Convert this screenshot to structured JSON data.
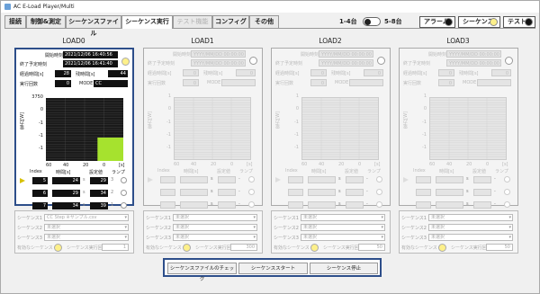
{
  "window_title": "AC E-Load Player/Multi",
  "tabs": [
    {
      "label": "接続",
      "state": "normal"
    },
    {
      "label": "制御&測定",
      "state": "normal"
    },
    {
      "label": "シーケンスファイル",
      "state": "normal"
    },
    {
      "label": "シーケンス実行",
      "state": "active"
    },
    {
      "label": "テスト機能",
      "state": "disabled"
    },
    {
      "label": "コンフィグ",
      "state": "normal"
    },
    {
      "label": "その他",
      "state": "normal"
    }
  ],
  "range": {
    "left": "1-4台",
    "right": "5-8台"
  },
  "indicators": [
    {
      "label": "アラーム",
      "color": "#111111"
    },
    {
      "label": "シーケンス",
      "color": "#fdf08a"
    },
    {
      "label": "テスト",
      "color": "#111111"
    }
  ],
  "loads": [
    {
      "title": "LOAD0",
      "active": true,
      "start_label": "開始時刻",
      "start": "2021/12/06 16:40:56",
      "end_label": "終了予定時刻",
      "end": "2021/12/06 16:41:40",
      "elapsed_label": "経過時間[s]",
      "elapsed": "28",
      "remain_label": "残時間[s]",
      "remain": "44",
      "count_label": "実行回数",
      "count": "0",
      "mode_label": "MODE",
      "mode": "CC",
      "ylabel": "電力[W]",
      "yticks": [
        "3750",
        "0",
        "-1",
        "-1",
        "-1"
      ],
      "xticks": [
        "60",
        "40",
        "20",
        "0"
      ],
      "xunit": "[s]",
      "headers": [
        "Index",
        "時間[s]",
        "設定値",
        "ランプ"
      ],
      "rows": [
        {
          "index": "5",
          "time": "24",
          "set": "29",
          "tunit": "s",
          "sunit": "3"
        },
        {
          "index": "6",
          "time": "29",
          "set": "34",
          "tunit": "s",
          "sunit": "2"
        },
        {
          "index": "7",
          "time": "34",
          "set": "39",
          "tunit": "s",
          "sunit": "1"
        }
      ],
      "seq": [
        {
          "label": "シーケンス1",
          "value": "CC Step ※サンプル.csv"
        },
        {
          "label": "シーケンス2",
          "value": "未選択"
        },
        {
          "label": "シーケンス3",
          "value": "未選択"
        }
      ],
      "valid_label": "有効なシーケンス",
      "repeat_label": "シーケンス実行回数",
      "repeat": "1"
    },
    {
      "title": "LOAD1",
      "active": false,
      "start_label": "開始時刻",
      "start": "YYYY/MM/DD 00:00:00",
      "end_label": "終了予定時刻",
      "end": "YYYY/MM/DD 00:00:00",
      "elapsed_label": "経過時間[s]",
      "elapsed": "0",
      "remain_label": "残時間[s]",
      "remain": "0",
      "count_label": "実行回数",
      "count": "0",
      "mode_label": "MODE",
      "mode": "",
      "ylabel": "電力[W]",
      "yticks": [
        "1",
        "0",
        "-1",
        "-1",
        "-1"
      ],
      "xticks": [
        "60",
        "40",
        "20",
        "0"
      ],
      "xunit": "[s]",
      "headers": [
        "Index",
        "時間[s]",
        "設定値",
        "ランプ"
      ],
      "rows": [
        {
          "index": "",
          "time": "",
          "set": "",
          "tunit": "s",
          "sunit": "-"
        },
        {
          "index": "",
          "time": "",
          "set": "",
          "tunit": "s",
          "sunit": "-"
        },
        {
          "index": "",
          "time": "",
          "set": "",
          "tunit": "s",
          "sunit": "-"
        }
      ],
      "seq": [
        {
          "label": "シーケンス1",
          "value": "未選択"
        },
        {
          "label": "シーケンス2",
          "value": "未選択"
        },
        {
          "label": "シーケンス3",
          "value": "未選択"
        }
      ],
      "valid_label": "有効なシーケンス",
      "repeat_label": "シーケンス実行回数",
      "repeat": "300"
    },
    {
      "title": "LOAD2",
      "active": false,
      "start_label": "開始時刻",
      "start": "YYYY/MM/DD 00:00:00",
      "end_label": "終了予定時刻",
      "end": "YYYY/MM/DD 00:00:00",
      "elapsed_label": "経過時間[s]",
      "elapsed": "0",
      "remain_label": "残時間[s]",
      "remain": "0",
      "count_label": "実行回数",
      "count": "0",
      "mode_label": "MODE",
      "mode": "",
      "ylabel": "電力[W]",
      "yticks": [
        "1",
        "0",
        "-1",
        "-1",
        "-1"
      ],
      "xticks": [
        "60",
        "40",
        "20",
        "0"
      ],
      "xunit": "[s]",
      "headers": [
        "Index",
        "時間[s]",
        "設定値",
        "ランプ"
      ],
      "rows": [
        {
          "index": "",
          "time": "",
          "set": "",
          "tunit": "s",
          "sunit": "-"
        },
        {
          "index": "",
          "time": "",
          "set": "",
          "tunit": "s",
          "sunit": "-"
        },
        {
          "index": "",
          "time": "",
          "set": "",
          "tunit": "s",
          "sunit": "-"
        }
      ],
      "seq": [
        {
          "label": "シーケンス1",
          "value": "未選択"
        },
        {
          "label": "シーケンス2",
          "value": "未選択"
        },
        {
          "label": "シーケンス3",
          "value": "未選択"
        }
      ],
      "valid_label": "有効なシーケンス",
      "repeat_label": "シーケンス実行回数",
      "repeat": "50"
    },
    {
      "title": "LOAD3",
      "active": false,
      "start_label": "開始時刻",
      "start": "YYYY/MM/DD 00:00:00",
      "end_label": "終了予定時刻",
      "end": "YYYY/MM/DD 00:00:00",
      "elapsed_label": "経過時間[s]",
      "elapsed": "0",
      "remain_label": "残時間[s]",
      "remain": "0",
      "count_label": "実行回数",
      "count": "0",
      "mode_label": "MODE",
      "mode": "",
      "ylabel": "電力[W]",
      "yticks": [
        "1",
        "0",
        "-1",
        "-1",
        "-1"
      ],
      "xticks": [
        "60",
        "40",
        "20",
        "0"
      ],
      "xunit": "[s]",
      "headers": [
        "Index",
        "時間[s]",
        "設定値",
        "ランプ"
      ],
      "rows": [
        {
          "index": "",
          "time": "",
          "set": "",
          "tunit": "s",
          "sunit": "-"
        },
        {
          "index": "",
          "time": "",
          "set": "",
          "tunit": "s",
          "sunit": "-"
        },
        {
          "index": "",
          "time": "",
          "set": "",
          "tunit": "s",
          "sunit": "-"
        }
      ],
      "seq": [
        {
          "label": "シーケンス1",
          "value": "未選択"
        },
        {
          "label": "シーケンス2",
          "value": "未選択"
        },
        {
          "label": "シーケンス3",
          "value": "未選択"
        }
      ],
      "valid_label": "有効なシーケンス",
      "repeat_label": "シーケンス実行回数",
      "repeat": "50"
    }
  ],
  "buttons": {
    "check": "シーケンスファイルのチェック",
    "start": "シーケンススタート",
    "stop": "シーケンス停止"
  },
  "load0_chart": {
    "type": "area",
    "x_range": [
      60,
      0
    ],
    "fill_from_x": 20,
    "fill_to_x": 0,
    "fill_color": "#a6e22e"
  }
}
